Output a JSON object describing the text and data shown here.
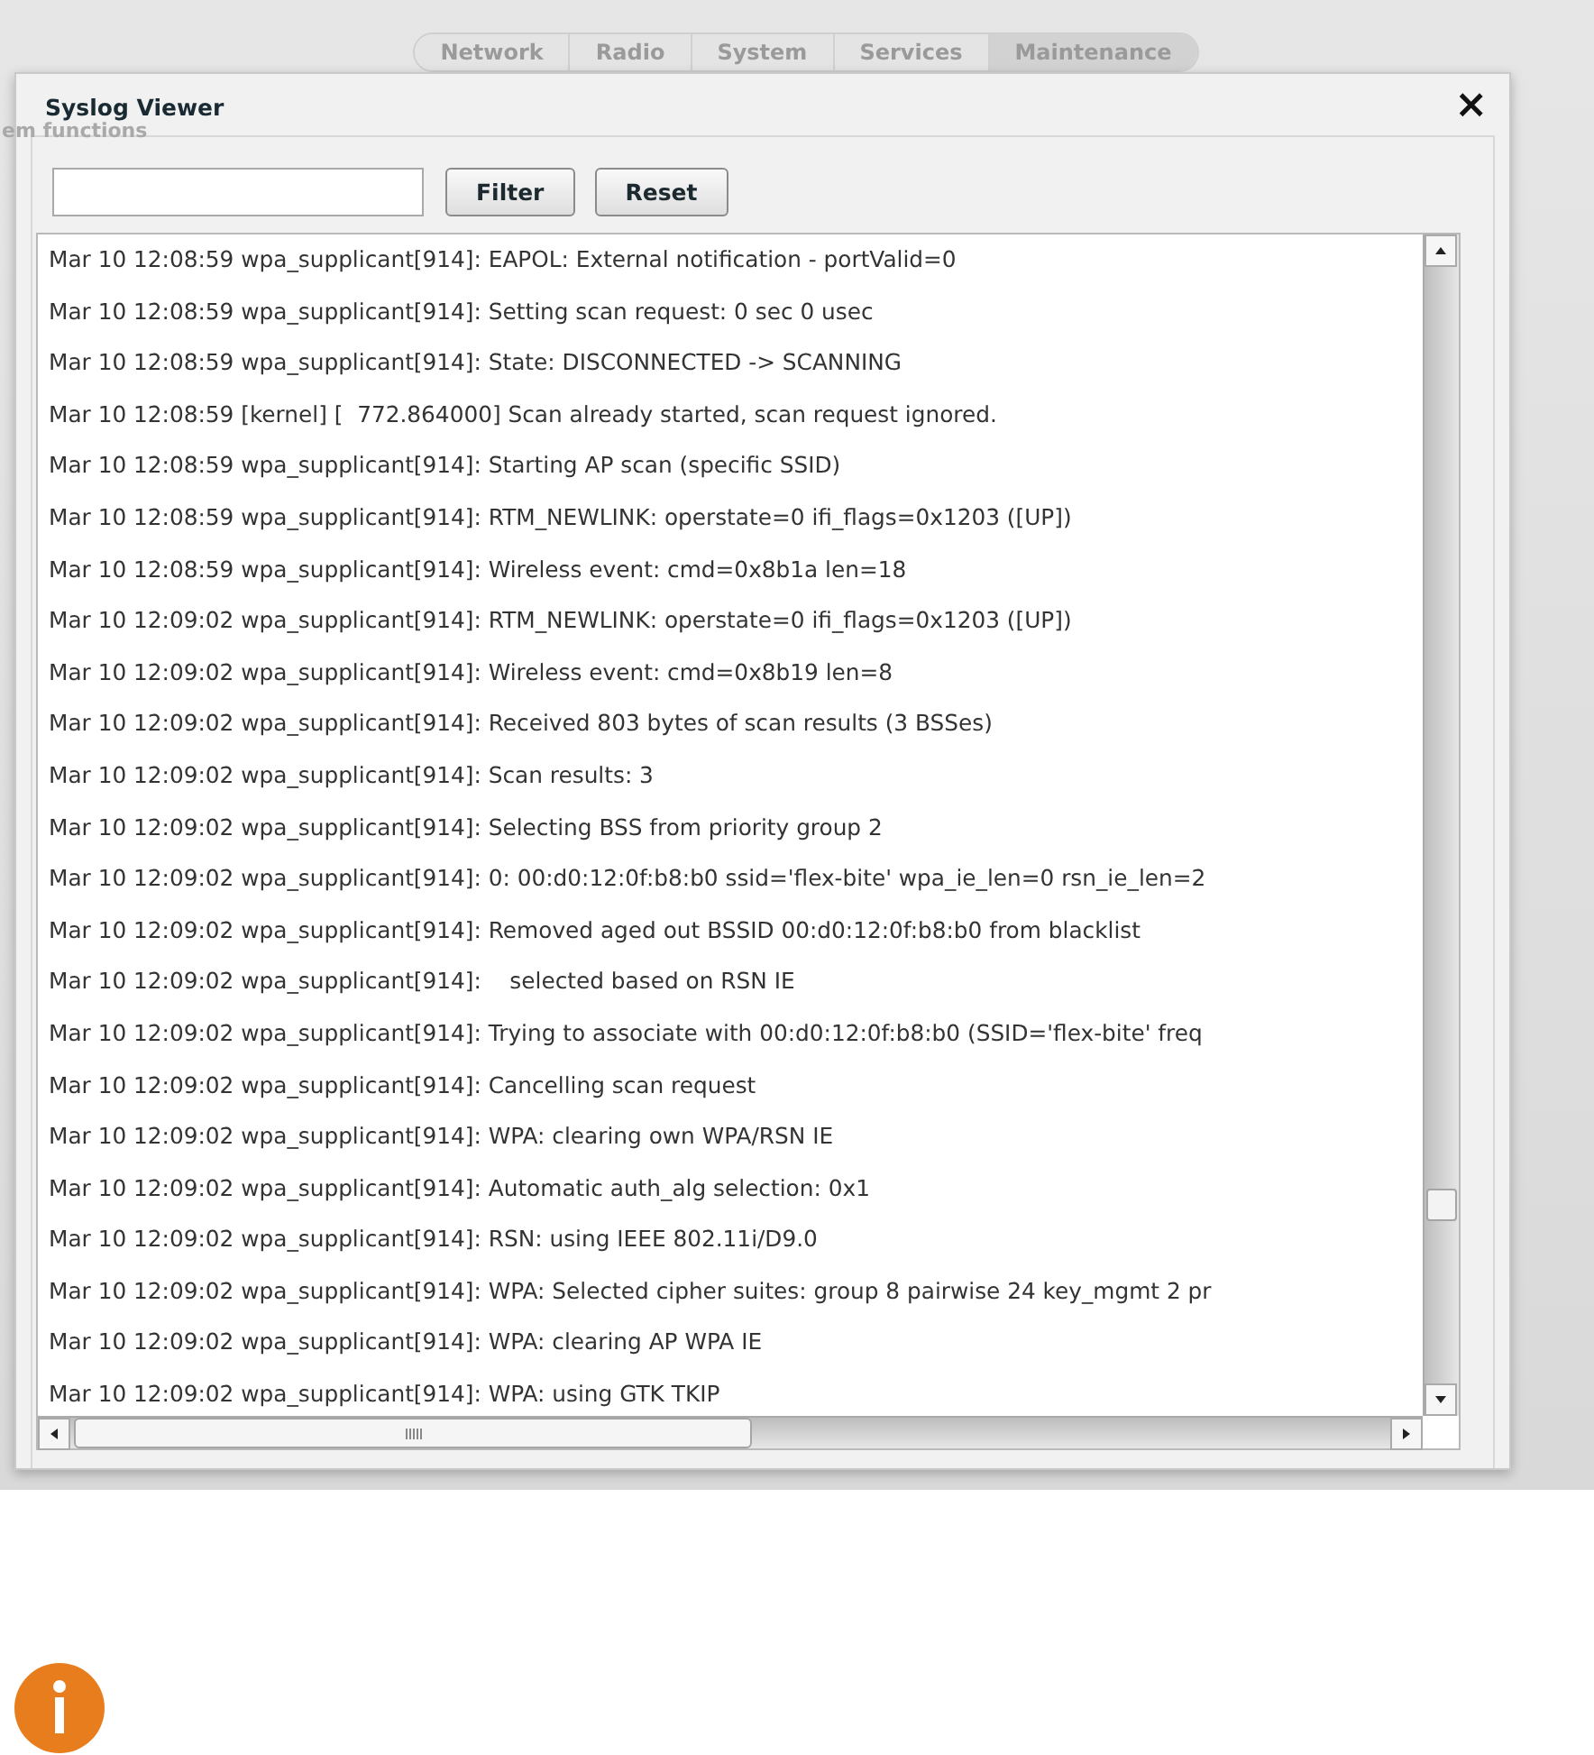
{
  "tabs": [
    {
      "label": "Network",
      "selected": false
    },
    {
      "label": "Radio",
      "selected": false
    },
    {
      "label": "System",
      "selected": false
    },
    {
      "label": "Services",
      "selected": false
    },
    {
      "label": "Maintenance",
      "selected": true
    }
  ],
  "background_label": "em functions",
  "dialog": {
    "title": "Syslog Viewer",
    "close": "×",
    "buttons": [
      "Filter",
      "Reset"
    ],
    "log_lines": [
      "Mar 10 12:08:59 wpa_supplicant[914]: EAPOL: External notification - portValid=0",
      "Mar 10 12:08:59 wpa_supplicant[914]: Setting scan request: 0 sec 0 usec",
      "Mar 10 12:08:59 wpa_supplicant[914]: State: DISCONNECTED -> SCANNING",
      "Mar 10 12:08:59 [kernel] [  772.864000] Scan already started, scan request ignored.",
      "Mar 10 12:08:59 wpa_supplicant[914]: Starting AP scan (specific SSID)",
      "Mar 10 12:08:59 wpa_supplicant[914]: RTM_NEWLINK: operstate=0 ifi_flags=0x1203 ([UP])",
      "Mar 10 12:08:59 wpa_supplicant[914]: Wireless event: cmd=0x8b1a len=18",
      "Mar 10 12:09:02 wpa_supplicant[914]: RTM_NEWLINK: operstate=0 ifi_flags=0x1203 ([UP])",
      "Mar 10 12:09:02 wpa_supplicant[914]: Wireless event: cmd=0x8b19 len=8",
      "Mar 10 12:09:02 wpa_supplicant[914]: Received 803 bytes of scan results (3 BSSes)",
      "Mar 10 12:09:02 wpa_supplicant[914]: Scan results: 3",
      "Mar 10 12:09:02 wpa_supplicant[914]: Selecting BSS from priority group 2",
      "Mar 10 12:09:02 wpa_supplicant[914]: 0: 00:d0:12:0f:b8:b0 ssid='flex-bite' wpa_ie_len=0 rsn_ie_len=2",
      "Mar 10 12:09:02 wpa_supplicant[914]: Removed aged out BSSID 00:d0:12:0f:b8:b0 from blacklist",
      "Mar 10 12:09:02 wpa_supplicant[914]:    selected based on RSN IE",
      "Mar 10 12:09:02 wpa_supplicant[914]: Trying to associate with 00:d0:12:0f:b8:b0 (SSID='flex-bite' freq",
      "Mar 10 12:09:02 wpa_supplicant[914]: Cancelling scan request",
      "Mar 10 12:09:02 wpa_supplicant[914]: WPA: clearing own WPA/RSN IE",
      "Mar 10 12:09:02 wpa_supplicant[914]: Automatic auth_alg selection: 0x1",
      "Mar 10 12:09:02 wpa_supplicant[914]: RSN: using IEEE 802.11i/D9.0",
      "Mar 10 12:09:02 wpa_supplicant[914]: WPA: Selected cipher suites: group 8 pairwise 24 key_mgmt 2 pr",
      "Mar 10 12:09:02 wpa_supplicant[914]: WPA: clearing AP WPA IE",
      "Mar 10 12:09:02 wpa_supplicant[914]: WPA: using GTK TKIP"
    ]
  }
}
